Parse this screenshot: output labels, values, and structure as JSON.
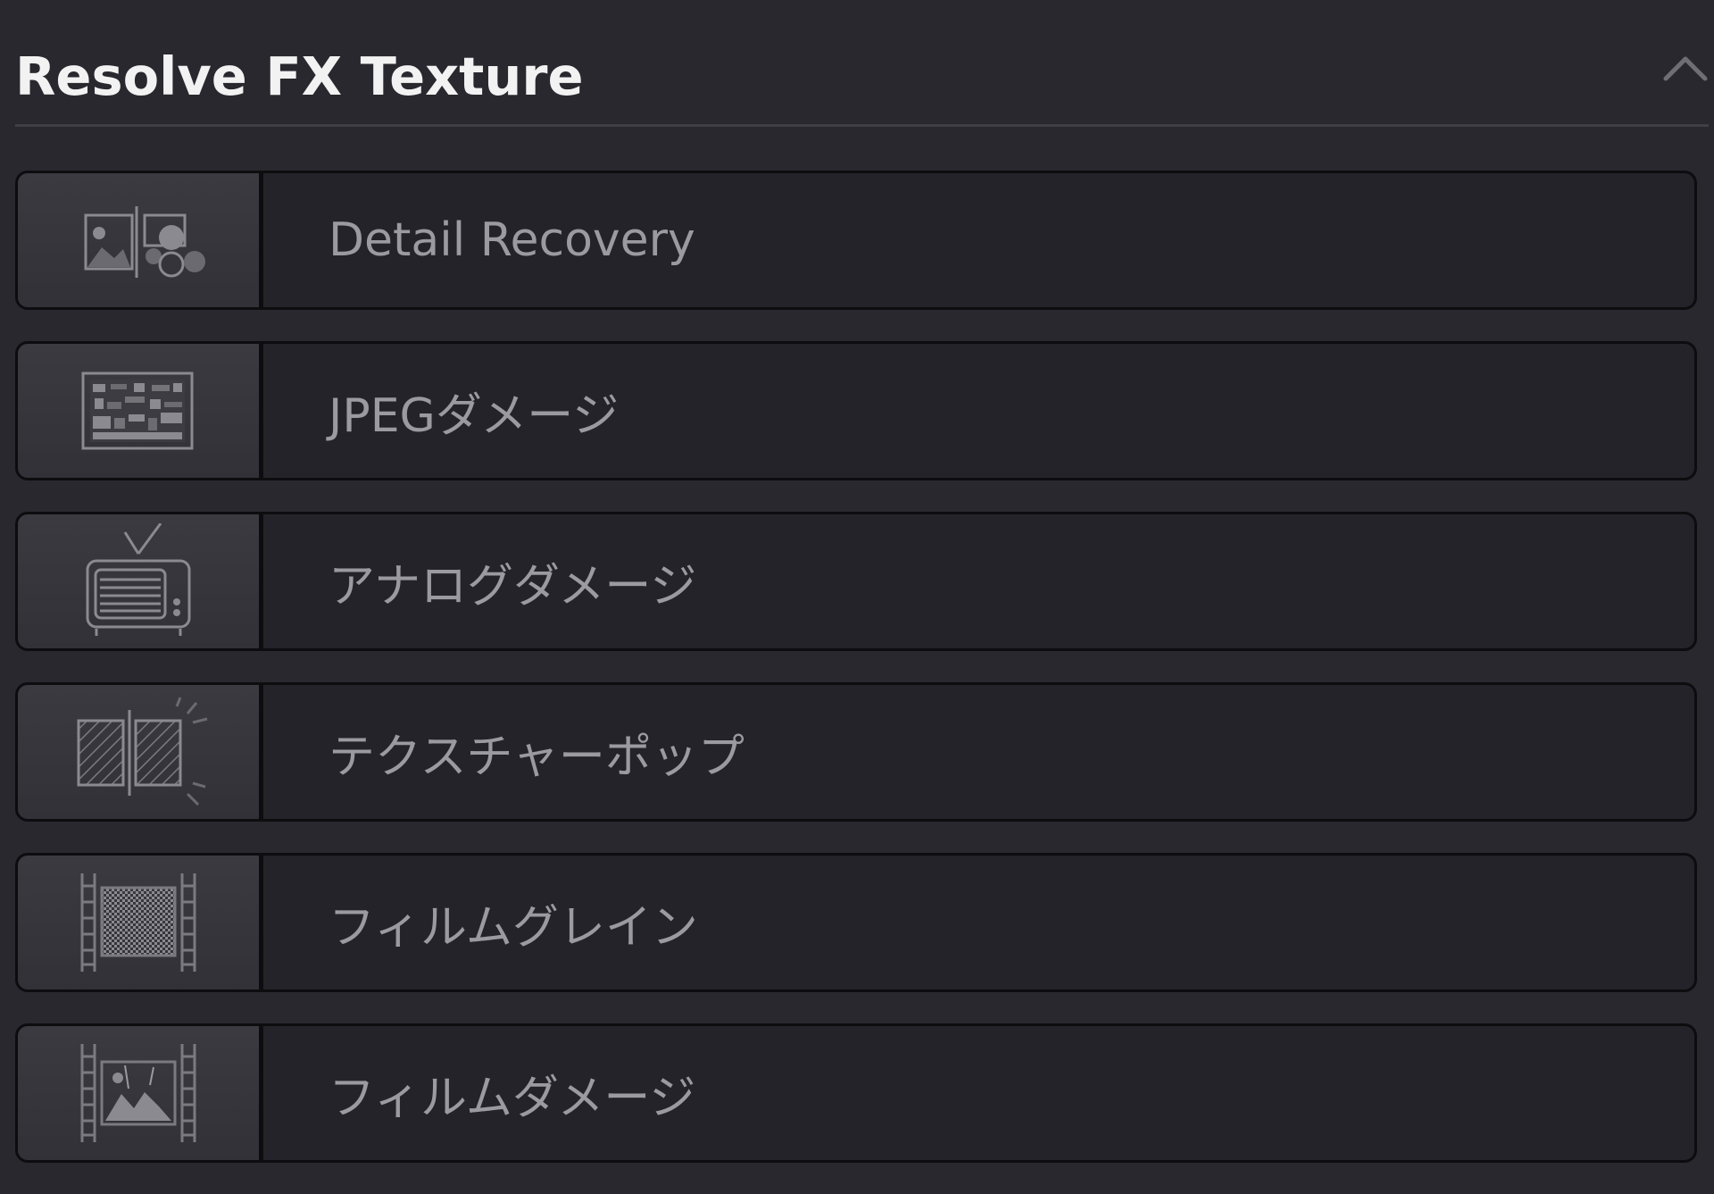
{
  "panel": {
    "title": "Resolve FX Texture",
    "collapse_icon": "chevron-up-icon"
  },
  "fx_items": [
    {
      "label": "Detail Recovery",
      "icon": "detail-recovery-icon"
    },
    {
      "label": "JPEGダメージ",
      "icon": "jpeg-damage-icon"
    },
    {
      "label": "アナログダメージ",
      "icon": "analog-damage-icon"
    },
    {
      "label": "テクスチャーポップ",
      "icon": "texture-pop-icon"
    },
    {
      "label": "フィルムグレイン",
      "icon": "film-grain-icon"
    },
    {
      "label": "フィルムダメージ",
      "icon": "film-damage-icon"
    }
  ],
  "colors": {
    "background": "#28282e",
    "item_background": "#232329",
    "thumb_background": "#37373d",
    "border": "#0d0d10",
    "title_text": "#f2f2f2",
    "label_text": "#9a9aa0",
    "icon_stroke": "#8a8a90"
  }
}
